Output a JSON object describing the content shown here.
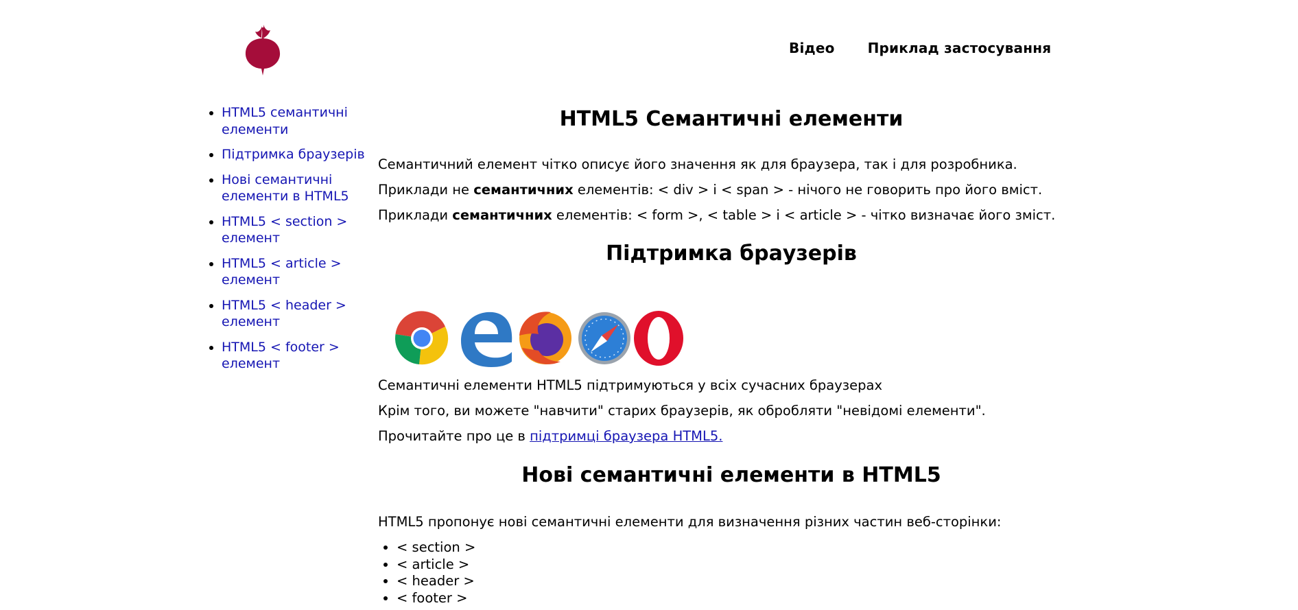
{
  "colors": {
    "brand": "#a50d3a",
    "link": "#1515b3",
    "text": "#000000"
  },
  "header": {
    "logo": "beet-logo",
    "nav": [
      "Відео",
      "Приклад застосування"
    ]
  },
  "sidebar": {
    "items": [
      "HTML5 семантичні елементи",
      "Підтримка браузерів",
      "Нові семантичні елементи в HTML5",
      "HTML5 < section > елемент",
      "HTML5 < article > елемент",
      "HTML5 < header > елемент",
      "HTML5 < footer > елемент"
    ]
  },
  "main": {
    "section1": {
      "title": "HTML5 Семантичні елементи",
      "p1": "Семантичний елемент чітко описує його значення як для браузера, так і для розробника.",
      "p2_pre": "Приклади не ",
      "p2_bold": "семантичних",
      "p2_post": " елементів: < div > і < span > - нічого не говорить про його вміст.",
      "p3_pre": "Приклади ",
      "p3_bold": "семантичних",
      "p3_post": " елементів: < form >, < table > і < article > - чітко визначає його зміст."
    },
    "section2": {
      "title": "Підтримка браузерів",
      "browser_icons": [
        "chrome-icon",
        "edge-icon",
        "firefox-icon",
        "safari-icon",
        "opera-icon"
      ],
      "p1": "Семантичні елементи HTML5 підтримуються у всіх сучасних браузерах",
      "p2": "Крім того, ви можете \"навчити\" старих браузерів, як обробляти \"невідомі елементи\".",
      "p3_pre": "Прочитайте про це в ",
      "p3_link": "підтримці браузера HTML5."
    },
    "section3": {
      "title": "Нові семантичні елементи в HTML5",
      "p1": "HTML5 пропонує нові семантичні елементи для визначення різних частин веб-сторінки:",
      "elements": [
        "< section >",
        "< article >",
        "< header >",
        "< footer >"
      ]
    }
  }
}
